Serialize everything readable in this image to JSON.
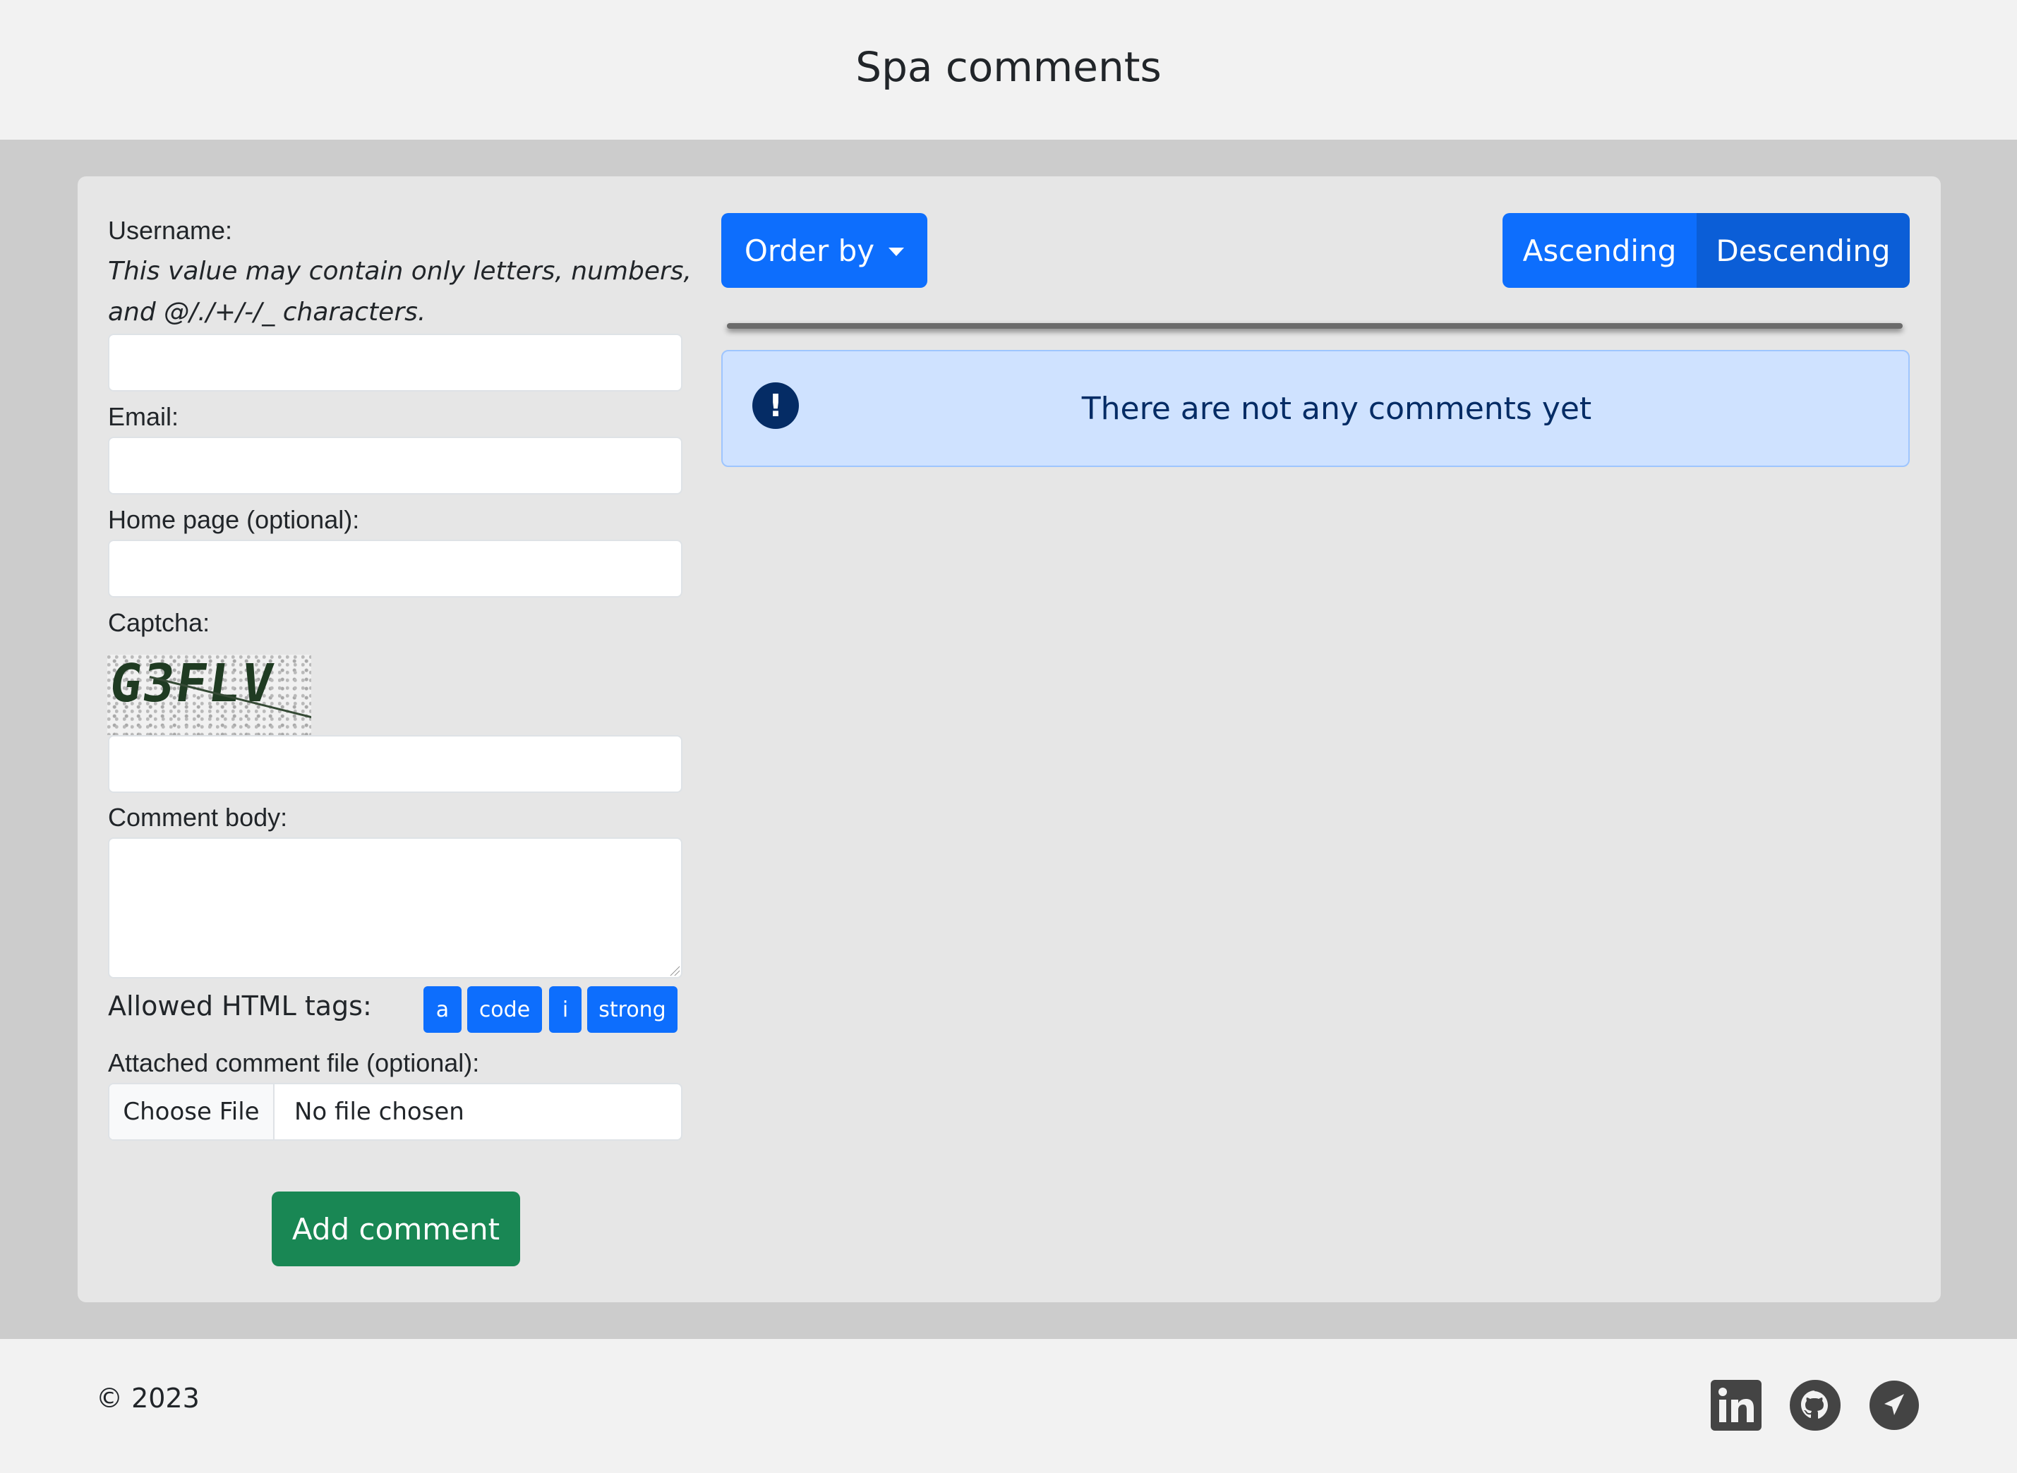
{
  "header": {
    "title": "Spa comments"
  },
  "form": {
    "username_label": "Username:",
    "username_hint": "This value may contain only letters, numbers, and @/./+/-/_ characters.",
    "username_value": "",
    "email_label": "Email:",
    "email_value": "",
    "homepage_label": "Home page (optional):",
    "homepage_value": "",
    "captcha_label": "Captcha:",
    "captcha_image_text": "G3FLV",
    "captcha_value": "",
    "body_label": "Comment body:",
    "body_value": "",
    "allowed_tags_label": "Allowed HTML tags:",
    "allowed_tags": [
      "a",
      "code",
      "i",
      "strong"
    ],
    "file_label": "Attached comment file (optional):",
    "file_button": "Choose File",
    "file_status": "No file chosen",
    "submit_label": "Add comment"
  },
  "comments": {
    "order_by_label": "Order by",
    "sort_ascending": "Ascending",
    "sort_descending": "Descending",
    "active_sort": "Descending",
    "empty_message": "There are not any comments yet",
    "alert_icon": "exclamation-circle-icon"
  },
  "footer": {
    "copyright": "© 2023",
    "social_icons": [
      "linkedin-icon",
      "github-icon",
      "telegram-icon"
    ]
  },
  "colors": {
    "primary": "#0d6efd",
    "primary_active": "#0b5ed7",
    "success": "#198754",
    "alert_bg": "#cfe2ff",
    "alert_text": "#052c65"
  }
}
